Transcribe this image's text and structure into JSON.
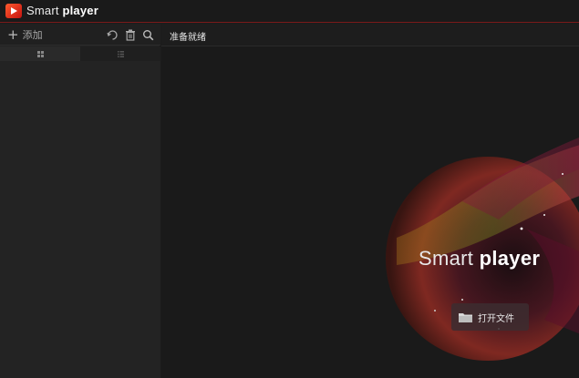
{
  "app": {
    "title_light": "Smart",
    "title_bold": "player"
  },
  "sidebar": {
    "add_label": "添加",
    "icons": [
      "refresh-icon",
      "trash-icon",
      "search-icon"
    ]
  },
  "main": {
    "status": "准备就绪",
    "brand_light": "Smart",
    "brand_bold": "player",
    "open_file_label": "打开文件"
  },
  "colors": {
    "accent": "#c4130f",
    "background": "#1a1a1a",
    "sidebar": "#222222"
  }
}
